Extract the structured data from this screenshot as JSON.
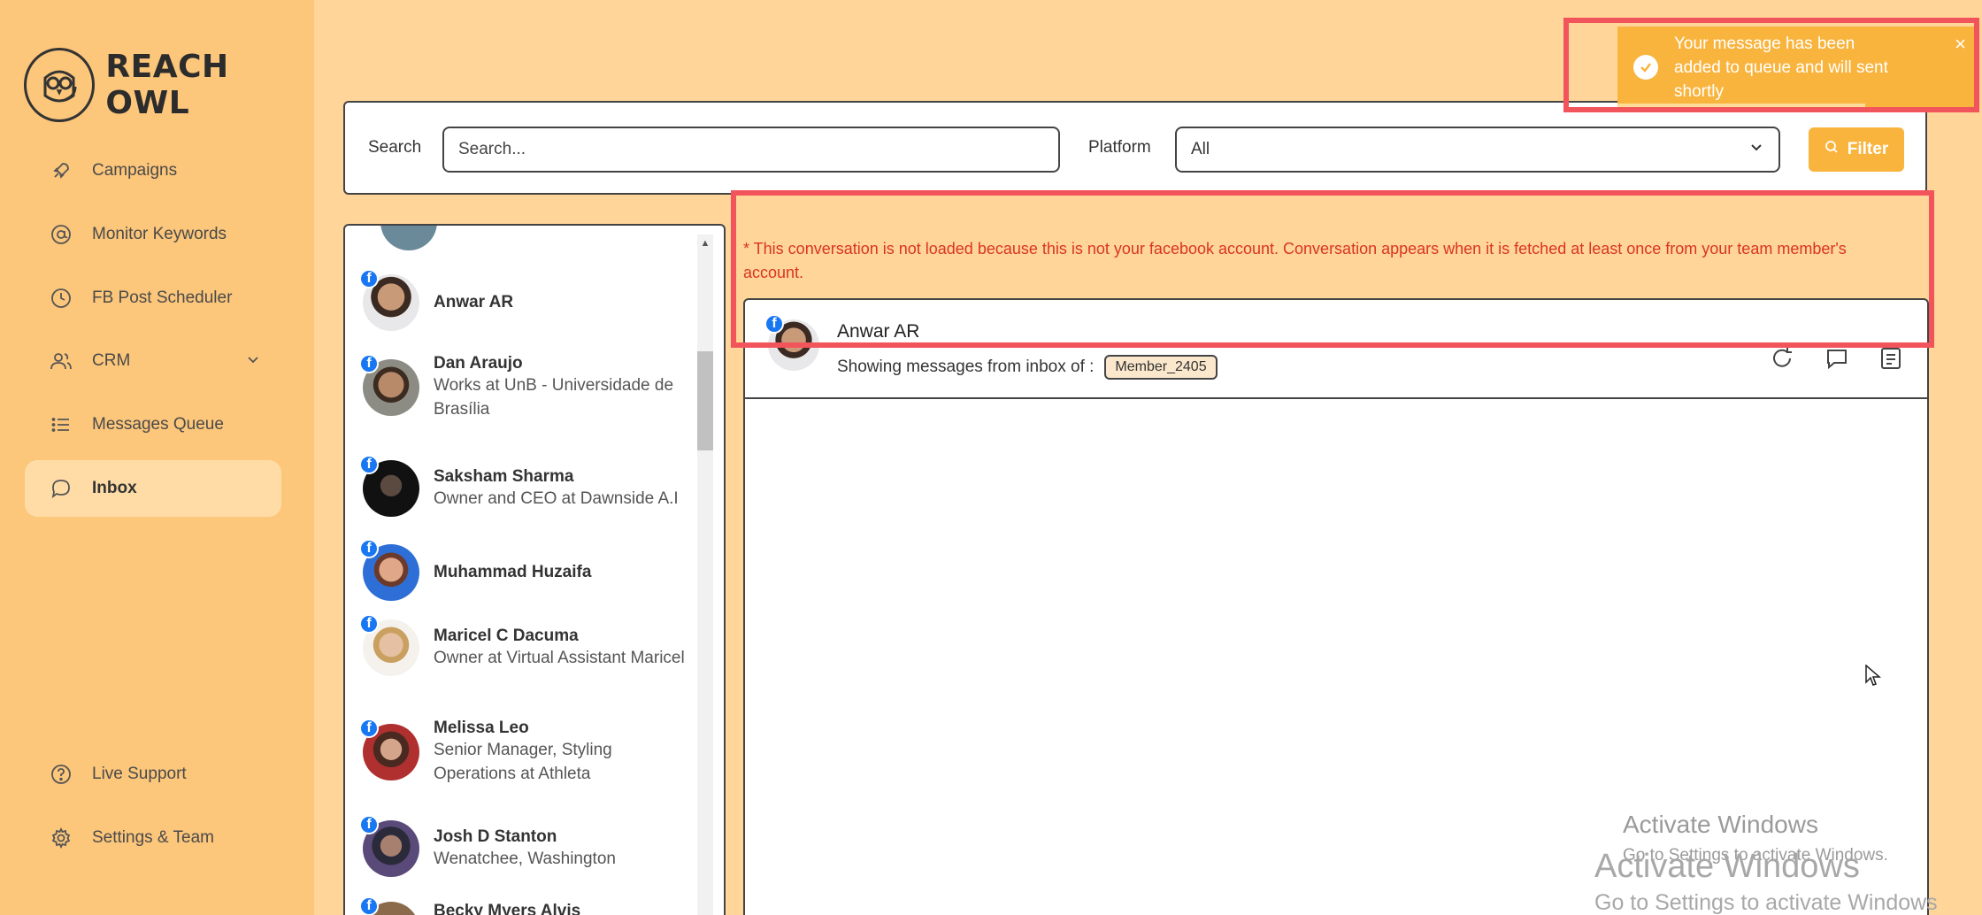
{
  "brand": {
    "name": "REACH OWL"
  },
  "sidebar": {
    "items": [
      {
        "label": "Campaigns",
        "icon": "rocket-icon"
      },
      {
        "label": "Monitor Keywords",
        "icon": "at-icon"
      },
      {
        "label": "FB Post Scheduler",
        "icon": "clock-icon"
      },
      {
        "label": "CRM",
        "icon": "users-icon"
      },
      {
        "label": "Messages Queue",
        "icon": "list-icon"
      },
      {
        "label": "Inbox",
        "icon": "chat-icon",
        "active": true
      }
    ],
    "bottom": [
      {
        "label": "Live Support",
        "icon": "help-icon"
      },
      {
        "label": "Settings & Team",
        "icon": "gear-icon"
      }
    ]
  },
  "filter": {
    "search_label": "Search",
    "search_placeholder": "Search...",
    "platform_label": "Platform",
    "platform_value": "All",
    "filter_button": "Filter"
  },
  "contacts": [
    {
      "name": "Anwar AR",
      "sub": ""
    },
    {
      "name": "Dan Araujo",
      "sub": "Works at UnB - Universidade de Brasília"
    },
    {
      "name": "Saksham Sharma",
      "sub": "Owner and CEO at Dawnside A.I"
    },
    {
      "name": "Muhammad Huzaifa",
      "sub": ""
    },
    {
      "name": "Maricel C Dacuma",
      "sub": "Owner at Virtual Assistant Maricel"
    },
    {
      "name": "Melissa Leo",
      "sub": "Senior Manager, Styling Operations at Athleta"
    },
    {
      "name": "Josh D Stanton",
      "sub": "Wenatchee, Washington"
    },
    {
      "name": "Becky Myers Alvis",
      "sub": ""
    }
  ],
  "conversation": {
    "notice": "* This conversation is not loaded because this is not your facebook account. Conversation appears when it is fetched at least once from your team member's account.",
    "name": "Anwar AR",
    "inbox_label": "Showing messages from inbox of :",
    "member": "Member_2405"
  },
  "toast": {
    "message": "Your message has been added to queue and will sent shortly"
  },
  "watermark": {
    "title": "Activate Windows",
    "subtitle": "Go to Settings to activate Windows.",
    "title2": "Activate Windows",
    "subtitle2": "Go to Settings to activate Windows"
  },
  "colors": {
    "accent": "#f9b43d",
    "sidebar": "#fcc67b",
    "background": "#ffd59a",
    "highlight": "#f2545b",
    "notice": "#d9361f"
  }
}
